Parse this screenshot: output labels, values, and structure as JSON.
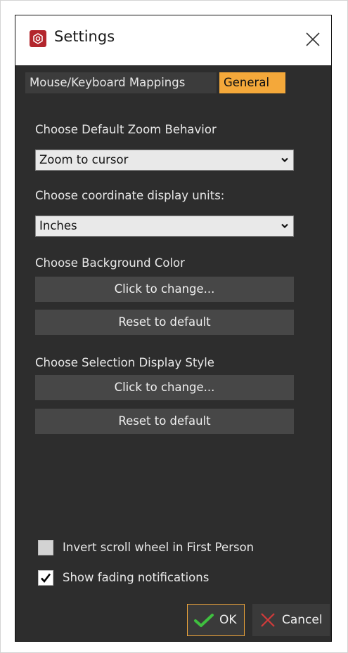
{
  "window": {
    "title": "Settings",
    "app_icon": "app-logo-icon",
    "close_icon": "close-icon"
  },
  "tabs": [
    {
      "label": "Mouse/Keyboard Mappings",
      "active": false
    },
    {
      "label": "General",
      "active": true
    }
  ],
  "zoom": {
    "label": "Choose Default Zoom Behavior",
    "selected": "Zoom to cursor"
  },
  "units": {
    "label": "Choose coordinate display units:",
    "selected": "Inches"
  },
  "background_color": {
    "label": "Choose Background Color",
    "change_label": "Click to change...",
    "reset_label": "Reset to default"
  },
  "selection_style": {
    "label": "Choose Selection Display Style",
    "change_label": "Click to change...",
    "reset_label": "Reset to default"
  },
  "options": {
    "invert_scroll": {
      "label": "Invert scroll wheel in First Person",
      "checked": false
    },
    "fading_notifications": {
      "label": "Show fading notifications",
      "checked": true
    }
  },
  "footer": {
    "ok_label": "OK",
    "cancel_label": "Cancel"
  },
  "colors": {
    "accent": "#f4a83a",
    "window_bg": "#2d2d2d",
    "button_bg": "#474747",
    "ok_check": "#3fbf3f",
    "cancel_x": "#d23a3a",
    "app_red": "#b3262d"
  }
}
